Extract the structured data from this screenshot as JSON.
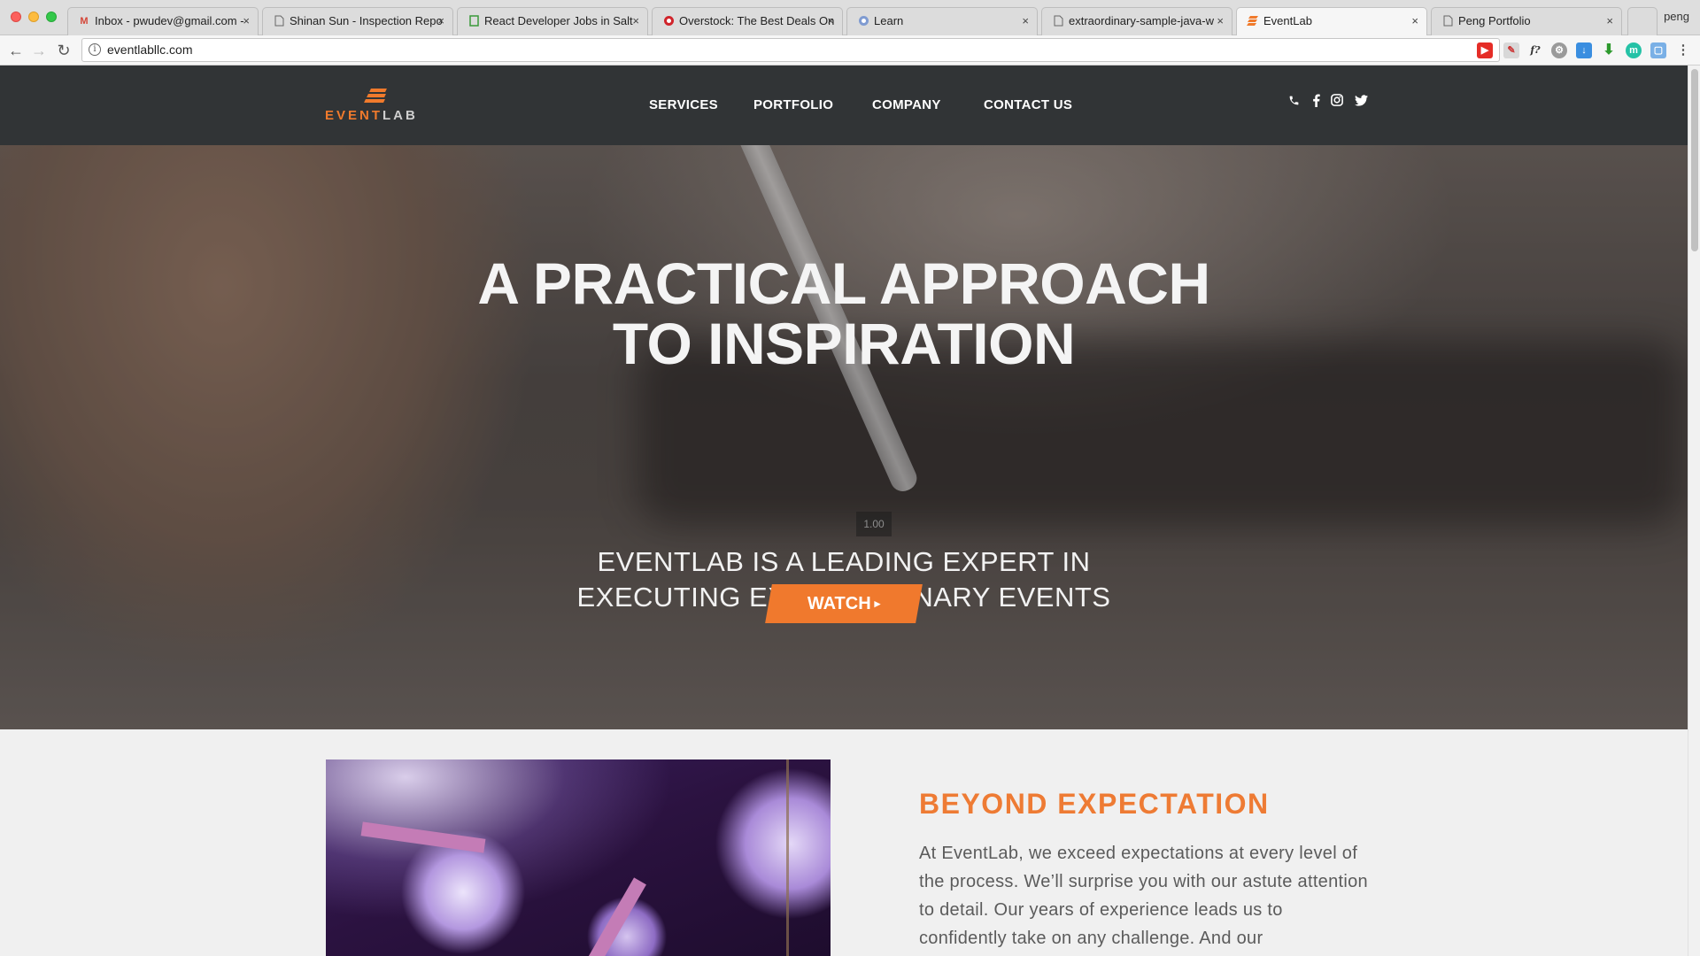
{
  "browser": {
    "tabs": [
      {
        "title": "Inbox - pwudev@gmail.com -",
        "icon": "gmail-icon",
        "close": "×"
      },
      {
        "title": "Shinan Sun - Inspection Repo",
        "icon": "document-icon",
        "close": "×"
      },
      {
        "title": "React Developer Jobs in Salt",
        "icon": "sheet-icon",
        "close": "×"
      },
      {
        "title": "Overstock: The Best Deals On",
        "icon": "overstock-icon",
        "close": "×"
      },
      {
        "title": "Learn",
        "icon": "globe-icon",
        "close": "×"
      },
      {
        "title": "extraordinary-sample-java-w",
        "icon": "document-icon",
        "close": "×"
      },
      {
        "title": "EventLab",
        "icon": "eventlab-icon",
        "close": "×",
        "active": true
      },
      {
        "title": "Peng Portfolio",
        "icon": "document-icon",
        "close": "×"
      }
    ],
    "profile": "peng",
    "back_icon": "←",
    "forward_icon": "→",
    "reload_icon": "↻",
    "url": "eventlabllc.com",
    "info_icon": "i",
    "star_icon": "☆",
    "extensions": [
      "youtube-icon",
      "paint-icon",
      "formula-icon",
      "settings-icon",
      "download-blue-icon",
      "download-green-icon",
      "teal-circle-icon",
      "window-icon",
      "menu-icon"
    ]
  },
  "site": {
    "logo": {
      "part1": "EVENT",
      "part2": "LAB"
    },
    "nav": [
      "SERVICES",
      "PORTFOLIO",
      "COMPANY",
      "CONTACT US"
    ],
    "social": [
      "phone-icon",
      "facebook-icon",
      "instagram-icon",
      "twitter-icon"
    ],
    "hero": {
      "headline_line1": "A PRACTICAL APPROACH",
      "headline_line2": "TO INSPIRATION",
      "volume": "1.00",
      "tagline_line1": "EVENTLAB IS A LEADING EXPERT IN",
      "tagline_line2": "EXECUTING EXTRAORDINARY EVENTS",
      "cta": "WATCH",
      "cta_icon": "▸"
    },
    "about": {
      "heading": "BEYOND EXPECTATION",
      "body": "At EventLab, we exceed expectations at every level of the process. We’ll surprise you with our astute attention to detail. Our years of experience leads us to confidently take on any challenge. And our"
    }
  },
  "colors": {
    "accent": "#f0792d",
    "nav_bg": "#313436",
    "section_bg": "#f0f0f0"
  }
}
